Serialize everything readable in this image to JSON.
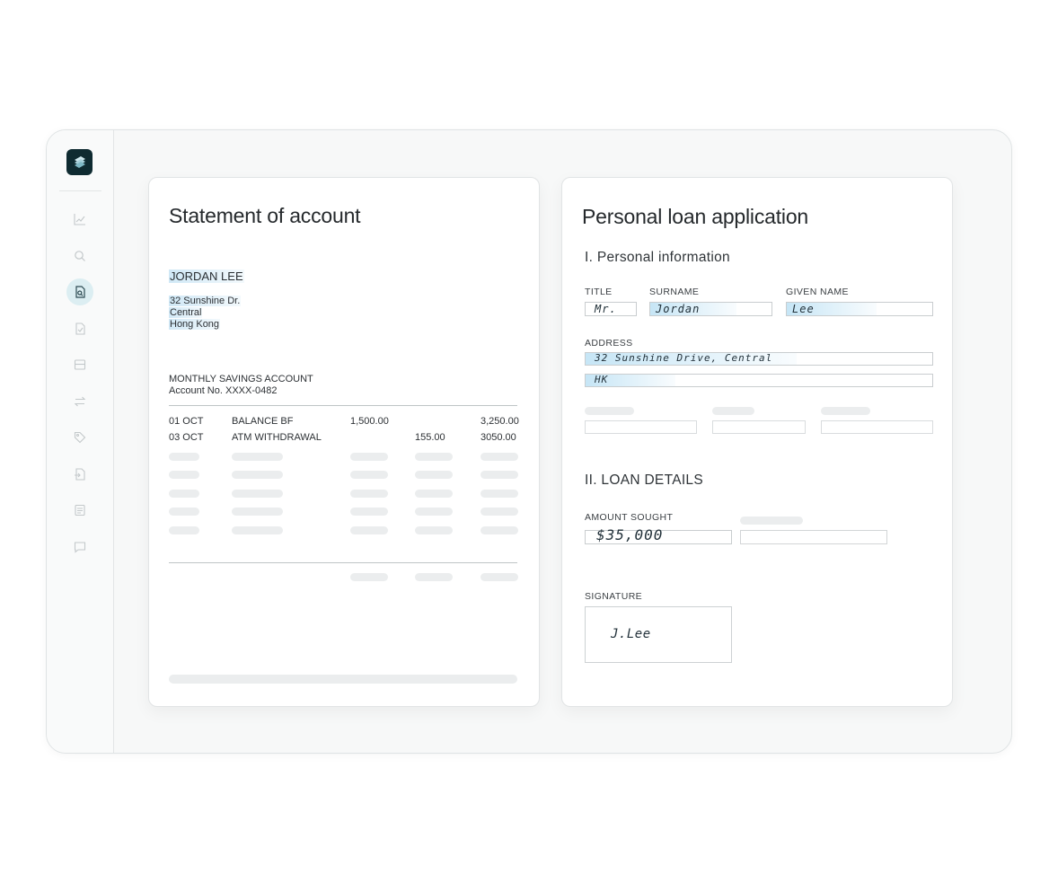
{
  "sidebar": {
    "logo": "app-logo",
    "items": [
      {
        "icon": "chart-line-icon",
        "active": false
      },
      {
        "icon": "search-icon",
        "active": false
      },
      {
        "icon": "document-scan-icon",
        "active": true
      },
      {
        "icon": "document-check-icon",
        "active": false
      },
      {
        "icon": "table-icon",
        "active": false
      },
      {
        "icon": "transfer-arrows-icon",
        "active": false
      },
      {
        "icon": "tag-icon",
        "active": false
      },
      {
        "icon": "document-export-icon",
        "active": false
      },
      {
        "icon": "receipt-icon",
        "active": false
      },
      {
        "icon": "chat-bubble-icon",
        "active": false
      }
    ]
  },
  "statement": {
    "title": "Statement of account",
    "customer_name": "JORDAN LEE",
    "address": [
      "32 Sunshine Dr.",
      "Central",
      "Hong Kong"
    ],
    "account_type": "MONTHLY SAVINGS ACCOUNT",
    "account_number": "Account No. XXXX-0482",
    "rows": [
      {
        "date": "01 OCT",
        "description": "BALANCE BF",
        "debit": "1,500.00",
        "credit": "",
        "balance": "3,250.00"
      },
      {
        "date": "03 OCT",
        "description": "ATM WITHDRAWAL",
        "debit": "",
        "credit": "155.00",
        "balance": "3050.00"
      }
    ]
  },
  "loan": {
    "title": "Personal loan application",
    "section1": "I. Personal information",
    "labels": {
      "title": "TITLE",
      "surname": "SURNAME",
      "given_name": "GIVEN NAME",
      "address": "ADDRESS",
      "amount": "AMOUNT SOUGHT",
      "signature": "SIGNATURE"
    },
    "values": {
      "title": "Mr.",
      "surname": "Jordan",
      "given_name": "Lee",
      "address_line1": "32 Sunshine Drive, Central",
      "address_line2": "HK",
      "amount": "$35,000",
      "signature": "J.Lee"
    },
    "section2": "II. LOAN DETAILS"
  },
  "colors": {
    "brand": "#0f2b31",
    "highlight": "#c8e4f4",
    "active_nav": "#dceef2"
  }
}
